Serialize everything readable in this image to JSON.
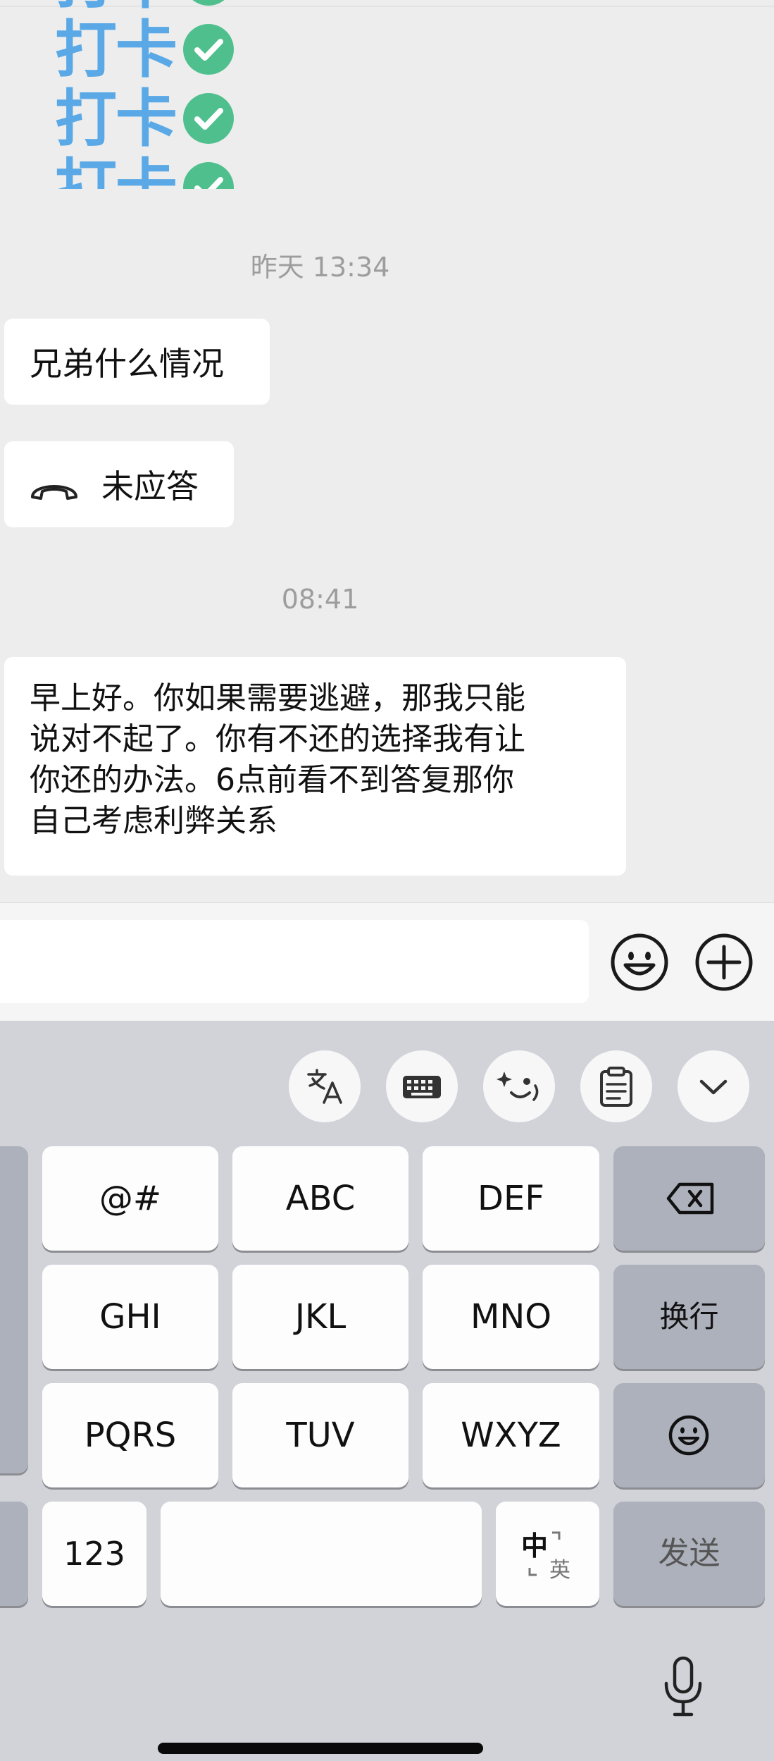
{
  "chat": {
    "sticker_text": "打卡",
    "timestamp_1": "昨天 13:34",
    "message_1": "兄弟什么情况",
    "call_status": "未应答",
    "timestamp_2": "08:41",
    "message_2_lines": [
      "早上好。你如果需要逃避，那我只能",
      "说对不起了。你有不还的选择我有让",
      "你还的办法。6点前看不到答复那你",
      "自己考虑利弊关系"
    ]
  },
  "input_bar": {
    "emoji_icon": "smiley-face-icon",
    "more_icon": "plus-circle-icon"
  },
  "keyboard": {
    "toolbar_icons": [
      "translate-icon",
      "keyboard-icon",
      "ai-face-icon",
      "clipboard-icon",
      "chevron-down-icon"
    ],
    "rows": [
      [
        "@#",
        "ABC",
        "DEF"
      ],
      [
        "GHI",
        "JKL",
        "MNO"
      ],
      [
        "PQRS",
        "TUV",
        "WXYZ"
      ]
    ],
    "delete_icon": "backspace-icon",
    "enter_label": "换行",
    "emoji_icon": "emoji-icon",
    "num_label": "123",
    "lang_zh": "中",
    "lang_en": "英",
    "send_label": "发送",
    "mic_icon": "microphone-icon"
  },
  "colors": {
    "chat_bg": "#ededed",
    "bubble": "#ffffff",
    "keyboard_bg": "#d1d3d9",
    "key_gray": "#adb1bb",
    "sticker_blue": "#5aa9e6",
    "check_green": "#4fc08d"
  }
}
